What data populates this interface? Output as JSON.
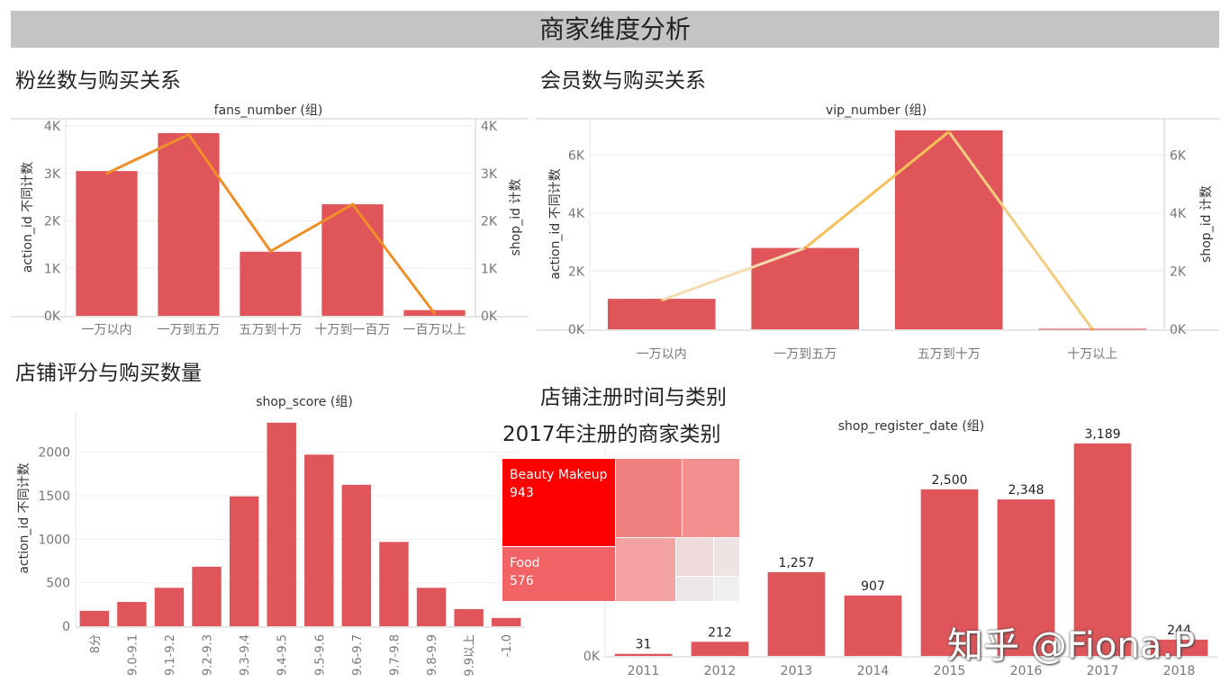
{
  "dashboard": {
    "title": "商家维度分析",
    "sections": {
      "fans": "粉丝数与购买关系",
      "vip": "会员数与购买关系",
      "score": "店铺评分与购买数量",
      "register": "店铺注册时间与类别",
      "treemap": "2017年注册的商家类别"
    },
    "watermark": "知乎 @Fiona.P"
  },
  "colors": {
    "bar": "#e0555a",
    "line": "#ef8f2a",
    "title_bar": "#c4c4c4",
    "treemap_top": "#ff0000"
  },
  "chart_data": [
    {
      "id": "fans",
      "type": "bar+line",
      "title": "fans_number (组)",
      "ylabel": "action_id 不同计数",
      "y2label": "shop_id 计数",
      "categories": [
        "一万以内",
        "一万到五万",
        "五万到十万",
        "十万到一百万",
        "一百万以上"
      ],
      "values": [
        3050,
        3850,
        1350,
        2350,
        120
      ],
      "line_values": [
        3000,
        3820,
        1360,
        2350,
        50
      ],
      "ylim": [
        0,
        4000
      ],
      "yticks": [
        {
          "v": 0,
          "label": "0K"
        },
        {
          "v": 1000,
          "label": "1K"
        },
        {
          "v": 2000,
          "label": "2K"
        },
        {
          "v": 3000,
          "label": "3K"
        },
        {
          "v": 4000,
          "label": "4K"
        }
      ],
      "grid": true
    },
    {
      "id": "vip",
      "type": "bar+line",
      "title": "vip_number (组)",
      "ylabel": "action_id 不同计数",
      "y2label": "shop_id 计数",
      "categories": [
        "一万以内",
        "一万到五万",
        "五万到十万",
        "十万以上"
      ],
      "values": [
        1050,
        2800,
        6850,
        20
      ],
      "line_values": [
        1000,
        2800,
        6800,
        0
      ],
      "ylim": [
        0,
        7000
      ],
      "yticks": [
        {
          "v": 0,
          "label": "0K"
        },
        {
          "v": 2000,
          "label": "2K"
        },
        {
          "v": 4000,
          "label": "4K"
        },
        {
          "v": 6000,
          "label": "6K"
        }
      ],
      "grid": true
    },
    {
      "id": "score",
      "type": "bar",
      "title": "shop_score (组)",
      "ylabel": "action_id 不同计数",
      "categories": [
        "8分",
        "9.0-9.1",
        "9.1-9.2",
        "9.2-9.3",
        "9.3-9.4",
        "9.4-9.5",
        "9.5-9.6",
        "9.6-9.7",
        "9.7-9.8",
        "9.8-9.9",
        "9.9以上",
        "-1.0"
      ],
      "values": [
        177,
        279,
        442,
        684,
        1493,
        2340,
        1973,
        1626,
        969,
        442,
        197,
        95
      ],
      "ylim": [
        0,
        2400
      ],
      "yticks": [
        {
          "v": 0,
          "label": "0"
        },
        {
          "v": 500,
          "label": "500"
        },
        {
          "v": 1000,
          "label": "1000"
        },
        {
          "v": 1500,
          "label": "1500"
        },
        {
          "v": 2000,
          "label": "2000"
        }
      ],
      "grid": true
    },
    {
      "id": "register",
      "type": "bar",
      "title": "shop_register_date (组)",
      "categories": [
        "2011",
        "2012",
        "2013",
        "2014",
        "2015",
        "2016",
        "2017",
        "2018"
      ],
      "values": [
        31,
        212,
        1257,
        907,
        2500,
        2348,
        3189,
        244
      ],
      "data_labels": [
        "31",
        "212",
        "1,257",
        "907",
        "2,500",
        "2,348",
        "3,189",
        "244"
      ],
      "ylim": [
        0,
        3200
      ],
      "yticks": [
        {
          "v": 0,
          "label": "0K"
        }
      ],
      "grid": true
    },
    {
      "id": "treemap",
      "type": "treemap",
      "items": [
        {
          "label": "Beauty Makeup",
          "value": "943",
          "color": "#ff0000"
        },
        {
          "label": "Food",
          "value": "576",
          "color": "#f26366"
        },
        {
          "color": "#f08080"
        },
        {
          "color": "#f29090"
        },
        {
          "color": "#f4a3a3"
        },
        {
          "color": "#eedada"
        },
        {
          "color": "#efe3e3"
        },
        {
          "color": "#ece6e6"
        },
        {
          "color": "#efefef"
        }
      ]
    }
  ]
}
